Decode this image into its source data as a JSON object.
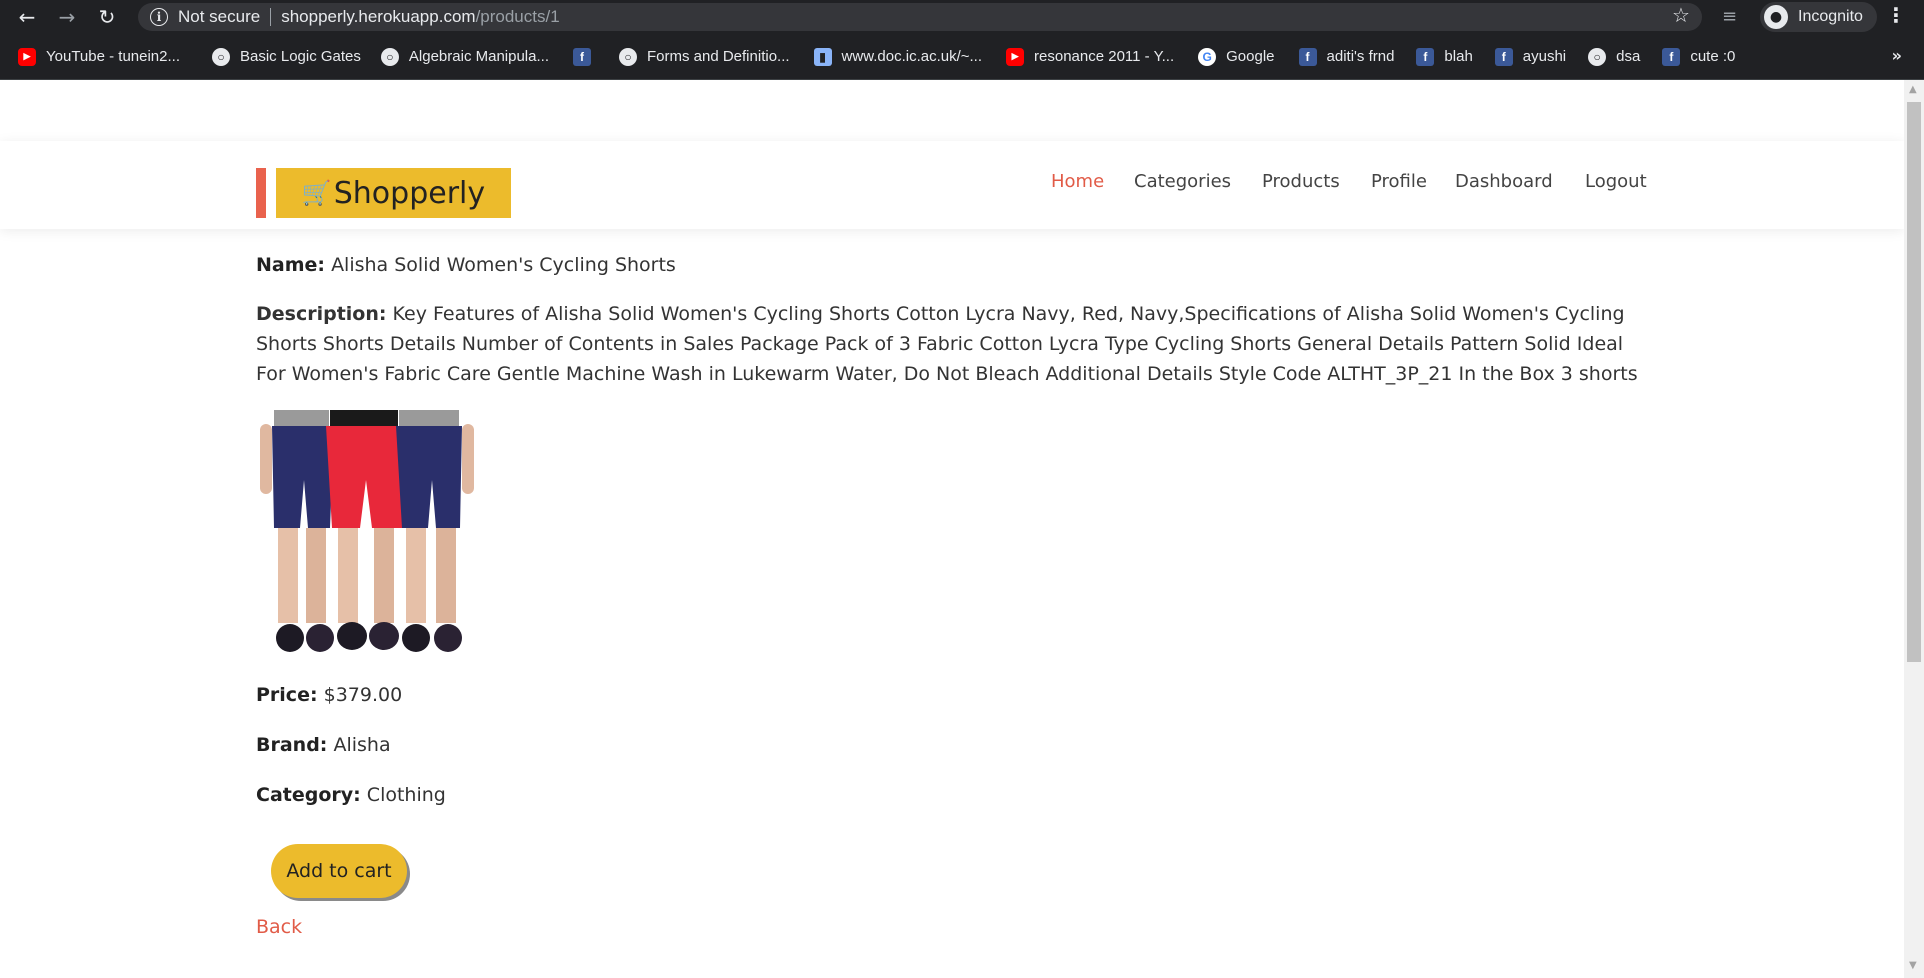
{
  "browser": {
    "not_secure": "Not secure",
    "url_host": "shopperly.herokuapp.com",
    "url_path": "/products/1",
    "incognito": "Incognito",
    "bookmarks": [
      {
        "label": "YouTube - tunein2...",
        "icon": "youtube-icon"
      },
      {
        "label": "Basic Logic Gates",
        "icon": "globe-icon"
      },
      {
        "label": "Algebraic Manipula...",
        "icon": "globe-icon"
      },
      {
        "label": "",
        "icon": "facebook-icon"
      },
      {
        "label": "Forms and Definitio...",
        "icon": "globe-icon"
      },
      {
        "label": "www.doc.ic.ac.uk/~...",
        "icon": "doc-icon"
      },
      {
        "label": "resonance 2011 - Y...",
        "icon": "youtube-icon"
      },
      {
        "label": "Google",
        "icon": "google-icon"
      },
      {
        "label": "aditi's frnd",
        "icon": "facebook-icon"
      },
      {
        "label": "blah",
        "icon": "facebook-icon"
      },
      {
        "label": "ayushi",
        "icon": "facebook-icon"
      },
      {
        "label": "dsa",
        "icon": "globe-icon"
      },
      {
        "label": "cute :0",
        "icon": "facebook-icon"
      }
    ],
    "more": "»"
  },
  "site": {
    "logo": "Shopperly",
    "nav": {
      "home": "Home",
      "categories": "Categories",
      "products": "Products",
      "profile": "Profile",
      "dashboard": "Dashboard",
      "logout": "Logout"
    }
  },
  "product": {
    "name_label": "Name:",
    "name": "Alisha Solid Women's Cycling Shorts",
    "description_label": "Description:",
    "description": "Key Features of Alisha Solid Women's Cycling Shorts Cotton Lycra Navy, Red, Navy,Specifications of Alisha Solid Women's Cycling Shorts Shorts Details Number of Contents in Sales Package Pack of 3 Fabric Cotton Lycra Type Cycling Shorts General Details Pattern Solid Ideal For Women's Fabric Care Gentle Machine Wash in Lukewarm Water, Do Not Bleach Additional Details Style Code ALTHT_3P_21 In the Box 3 shorts",
    "price_label": "Price:",
    "price": "$379.00",
    "brand_label": "Brand:",
    "brand": "Alisha",
    "category_label": "Category:",
    "category": "Clothing",
    "add_to_cart": "Add to cart",
    "back": "Back"
  },
  "colors": {
    "accent": "#e15b47",
    "logo_bg": "#ecbb2c",
    "button_bg": "#ecbb2c"
  }
}
